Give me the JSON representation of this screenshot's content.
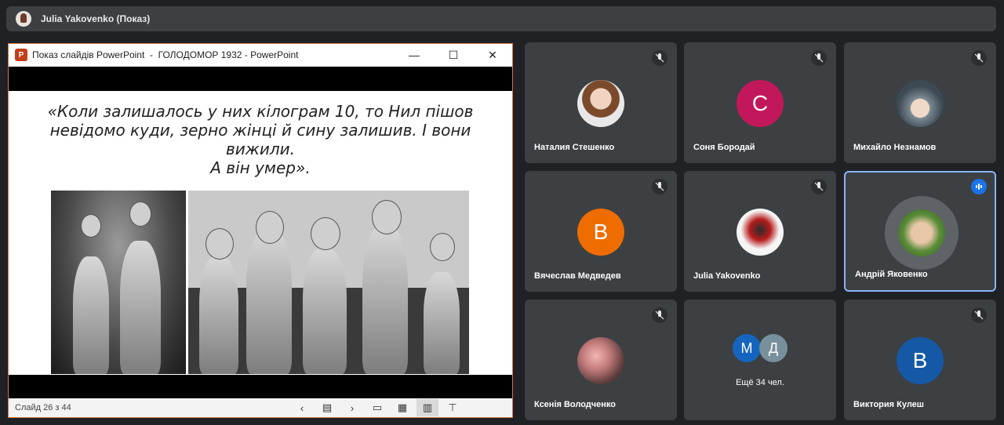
{
  "presenter": {
    "name": "Julia Yakovenko (Показ)"
  },
  "ppt": {
    "window_title": "Показ слайдів PowerPoint  -  ГОЛОДОМОР 1932 - PowerPoint",
    "logo_letter": "P",
    "minimize": "—",
    "maximize": "☐",
    "close": "✕",
    "quote_line1": "«Коли залишалось у них кілограм 10, то Нил пішов",
    "quote_line2": "невідомо куди, зерно жінці й сину залишив. І вони вижили.",
    "quote_line3": "А він умер».",
    "status": "Слайд 26 з 44",
    "tools": {
      "prev": "‹",
      "notes": "▤",
      "next": "›",
      "normal": "▭",
      "sorter": "▦",
      "reading": "▥",
      "present": "⊤"
    }
  },
  "participants": [
    {
      "name": "Наталия Стешенко",
      "avatar_type": "photo",
      "muted": true
    },
    {
      "name": "Соня Бородай",
      "initial": "С",
      "color": "#c2185b",
      "muted": true
    },
    {
      "name": "Михайло Незнамов",
      "avatar_type": "photo",
      "muted": true
    },
    {
      "name": "Вячеслав Медведев",
      "initial": "В",
      "color": "#ef6c00",
      "muted": true
    },
    {
      "name": "Julia Yakovenko",
      "avatar_type": "photo",
      "muted": true
    },
    {
      "name": "Андрій Яковенко",
      "avatar_type": "photo",
      "speaking": true
    },
    {
      "name": "Ксенія Володченко",
      "avatar_type": "photo",
      "muted": true
    },
    {
      "more_initials": [
        "М",
        "Д"
      ],
      "more_colors": [
        "#1565c0",
        "#78909c"
      ],
      "more_label": "Ещё 34 чел."
    },
    {
      "name": "Виктория Кулеш",
      "initial": "В",
      "color": "#1558a6",
      "muted": true
    }
  ],
  "icons": {
    "mic_off": "mic-off-icon",
    "speaking": "audio-level-icon"
  }
}
